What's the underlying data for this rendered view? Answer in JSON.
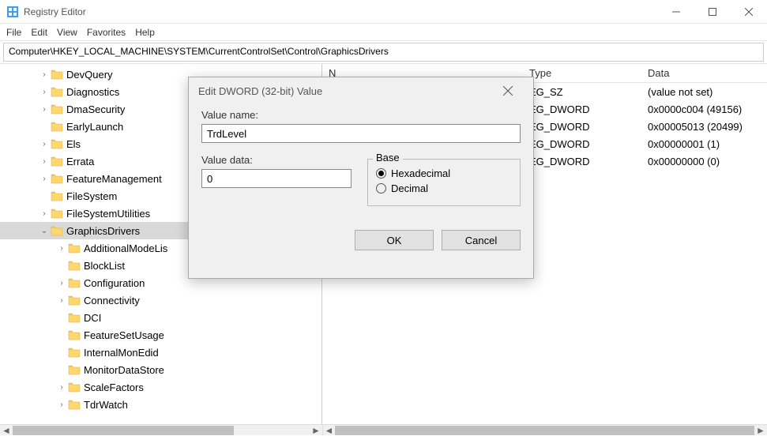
{
  "title": "Registry Editor",
  "menu": {
    "file": "File",
    "edit": "Edit",
    "view": "View",
    "favorites": "Favorites",
    "help": "Help"
  },
  "address": "Computer\\HKEY_LOCAL_MACHINE\\SYSTEM\\CurrentControlSet\\Control\\GraphicsDrivers",
  "tree": {
    "items": [
      {
        "label": "DevQuery",
        "indent": 1,
        "exp": "closed"
      },
      {
        "label": "Diagnostics",
        "indent": 1,
        "exp": "closed"
      },
      {
        "label": "DmaSecurity",
        "indent": 1,
        "exp": "closed"
      },
      {
        "label": "EarlyLaunch",
        "indent": 1,
        "exp": "none"
      },
      {
        "label": "Els",
        "indent": 1,
        "exp": "closed"
      },
      {
        "label": "Errata",
        "indent": 1,
        "exp": "closed"
      },
      {
        "label": "FeatureManagement",
        "indent": 1,
        "exp": "closed"
      },
      {
        "label": "FileSystem",
        "indent": 1,
        "exp": "none"
      },
      {
        "label": "FileSystemUtilities",
        "indent": 1,
        "exp": "closed"
      },
      {
        "label": "GraphicsDrivers",
        "indent": 1,
        "exp": "open",
        "selected": true
      },
      {
        "label": "AdditionalModeLis",
        "indent": 2,
        "exp": "closed"
      },
      {
        "label": "BlockList",
        "indent": 2,
        "exp": "none"
      },
      {
        "label": "Configuration",
        "indent": 2,
        "exp": "closed"
      },
      {
        "label": "Connectivity",
        "indent": 2,
        "exp": "closed"
      },
      {
        "label": "DCI",
        "indent": 2,
        "exp": "none"
      },
      {
        "label": "FeatureSetUsage",
        "indent": 2,
        "exp": "none"
      },
      {
        "label": "InternalMonEdid",
        "indent": 2,
        "exp": "none"
      },
      {
        "label": "MonitorDataStore",
        "indent": 2,
        "exp": "none"
      },
      {
        "label": "ScaleFactors",
        "indent": 2,
        "exp": "closed"
      },
      {
        "label": "TdrWatch",
        "indent": 2,
        "exp": "closed"
      }
    ]
  },
  "list": {
    "headers": {
      "name": "N",
      "type": "Type",
      "data": "Data"
    },
    "rows": [
      {
        "name": "",
        "type": "EG_SZ",
        "data": "(value not set)"
      },
      {
        "name": "",
        "type": "EG_DWORD",
        "data": "0x0000c004 (49156)"
      },
      {
        "name": "",
        "type": "EG_DWORD",
        "data": "0x00005013 (20499)"
      },
      {
        "name": "",
        "type": "EG_DWORD",
        "data": "0x00000001 (1)"
      },
      {
        "name": "",
        "type": "EG_DWORD",
        "data": "0x00000000 (0)"
      }
    ]
  },
  "dialog": {
    "title": "Edit DWORD (32-bit) Value",
    "value_name_label": "Value name:",
    "value_name": "TrdLevel",
    "value_data_label": "Value data:",
    "value_data": "0",
    "base_label": "Base",
    "hex_label": "Hexadecimal",
    "dec_label": "Decimal",
    "ok": "OK",
    "cancel": "Cancel"
  }
}
